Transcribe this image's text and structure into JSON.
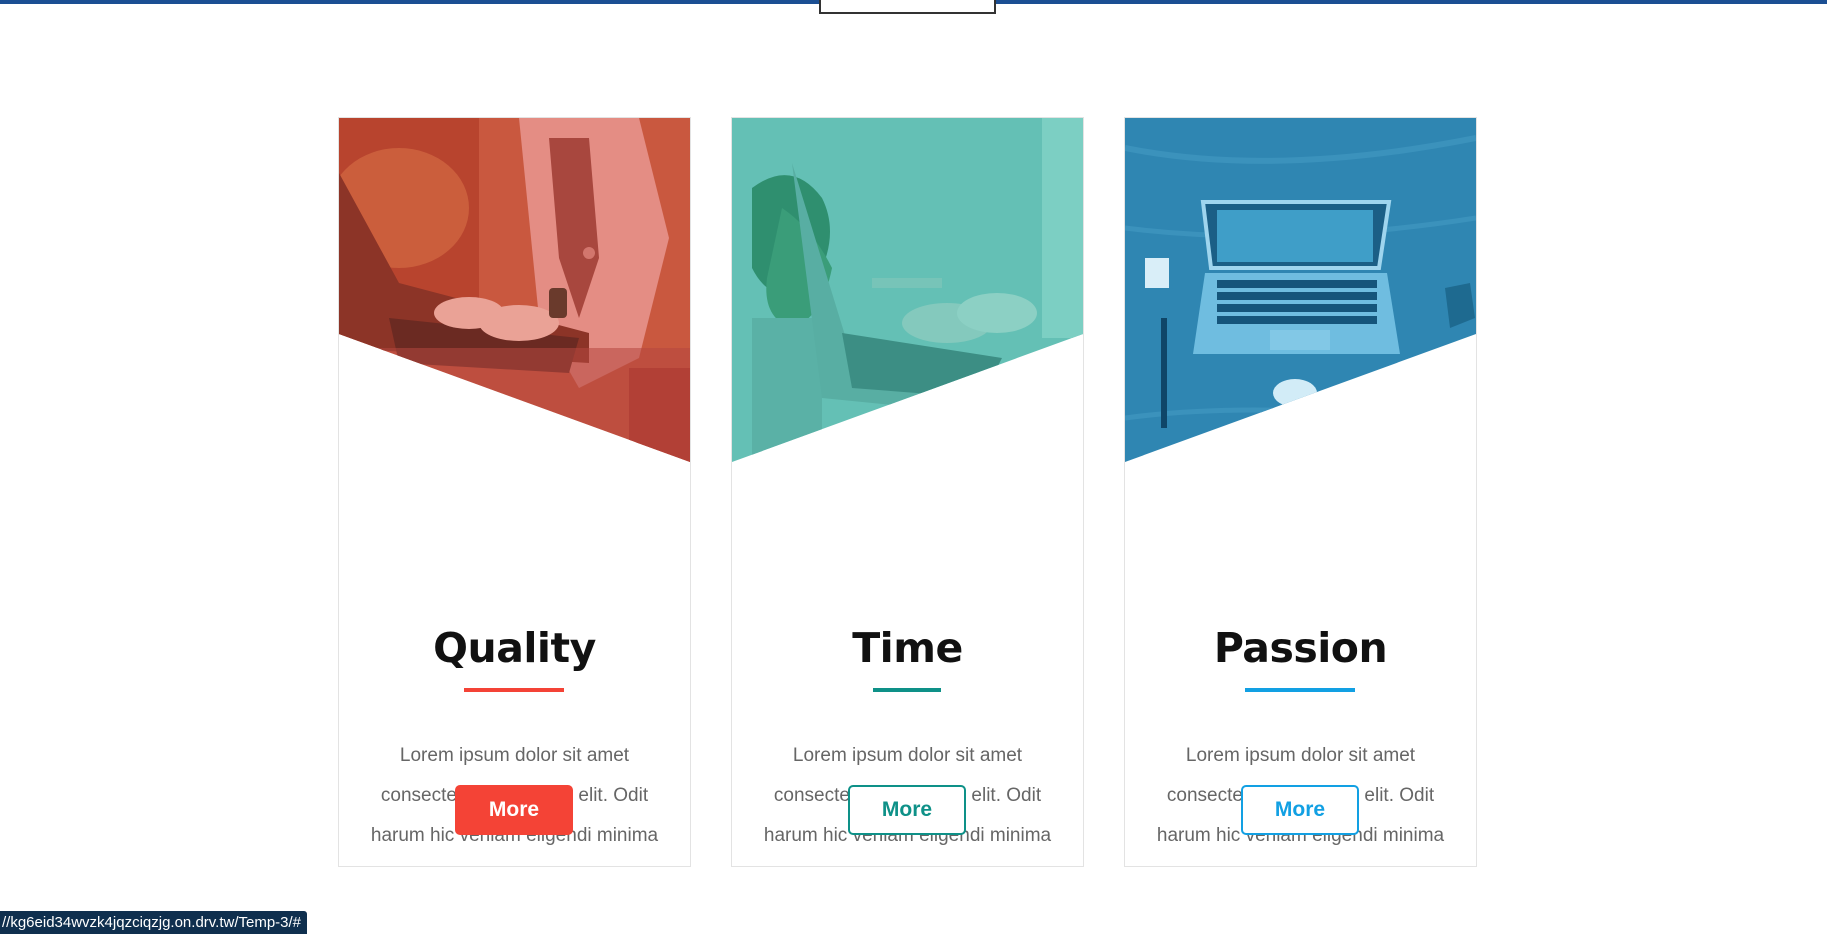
{
  "page": {
    "status_url": "//kg6eid34wvzk4jqzciqzjg.on.drv.tw/Temp-3/#"
  },
  "colors": {
    "top_bar": "#1b4f93",
    "quality_accent": "#f44336",
    "time_accent": "#0e9188",
    "passion_accent": "#12a0e3"
  },
  "cards": [
    {
      "title": "Quality",
      "description": "Lorem ipsum dolor sit amet consectetur adipisicing elit. Odit harum hic veniam eligendi minima",
      "button_label": "More",
      "accent": "#f44336",
      "button_style": "filled",
      "image": "woman-typing-on-laptop"
    },
    {
      "title": "Time",
      "description": "Lorem ipsum dolor sit amet consectetur adipisicing elit. Odit harum hic veniam eligendi minima",
      "button_label": "More",
      "accent": "#0e9188",
      "button_style": "outline",
      "image": "hands-on-laptop-keyboard-with-plant"
    },
    {
      "title": "Passion",
      "description": "Lorem ipsum dolor sit amet consectetur adipisicing elit. Odit harum hic veniam eligendi minima",
      "button_label": "More",
      "accent": "#12a0e3",
      "button_style": "outline",
      "image": "laptop-on-wooden-desk"
    }
  ]
}
